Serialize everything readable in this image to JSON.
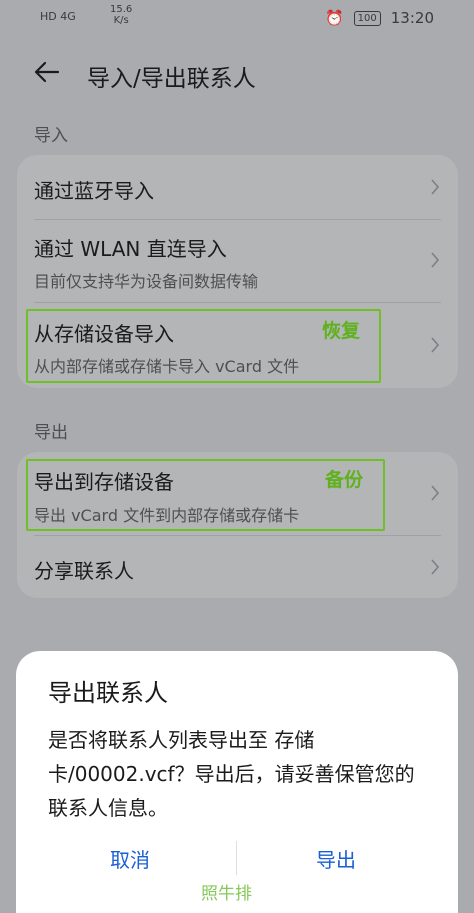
{
  "status_bar": {
    "signal": "HD 4G",
    "speed_value": "15.6",
    "speed_unit": "K/s",
    "battery": "100",
    "time": "13:20"
  },
  "header": {
    "title": "导入/导出联系人"
  },
  "import_section": {
    "label": "导入",
    "items": [
      {
        "title": "通过蓝牙导入"
      },
      {
        "title": "通过 WLAN 直连导入",
        "subtitle": "目前仅支持华为设备间数据传输"
      },
      {
        "title": "从存储设备导入",
        "subtitle": "从内部存储或存储卡导入 vCard 文件",
        "annotation": "恢复"
      }
    ]
  },
  "export_section": {
    "label": "导出",
    "items": [
      {
        "title": "导出到存储设备",
        "subtitle": "导出 vCard 文件到内部存储或存储卡",
        "annotation": "备份"
      },
      {
        "title": "分享联系人"
      }
    ]
  },
  "dialog": {
    "title": "导出联系人",
    "message": "是否将联系人列表导出至 存储卡/00002.vcf？导出后，请妥善保管您的联系人信息。",
    "cancel": "取消",
    "confirm": "导出"
  },
  "watermark": "照牛排",
  "colors": {
    "accent": "#1a5fd6",
    "annotation": "#5fb21d"
  }
}
